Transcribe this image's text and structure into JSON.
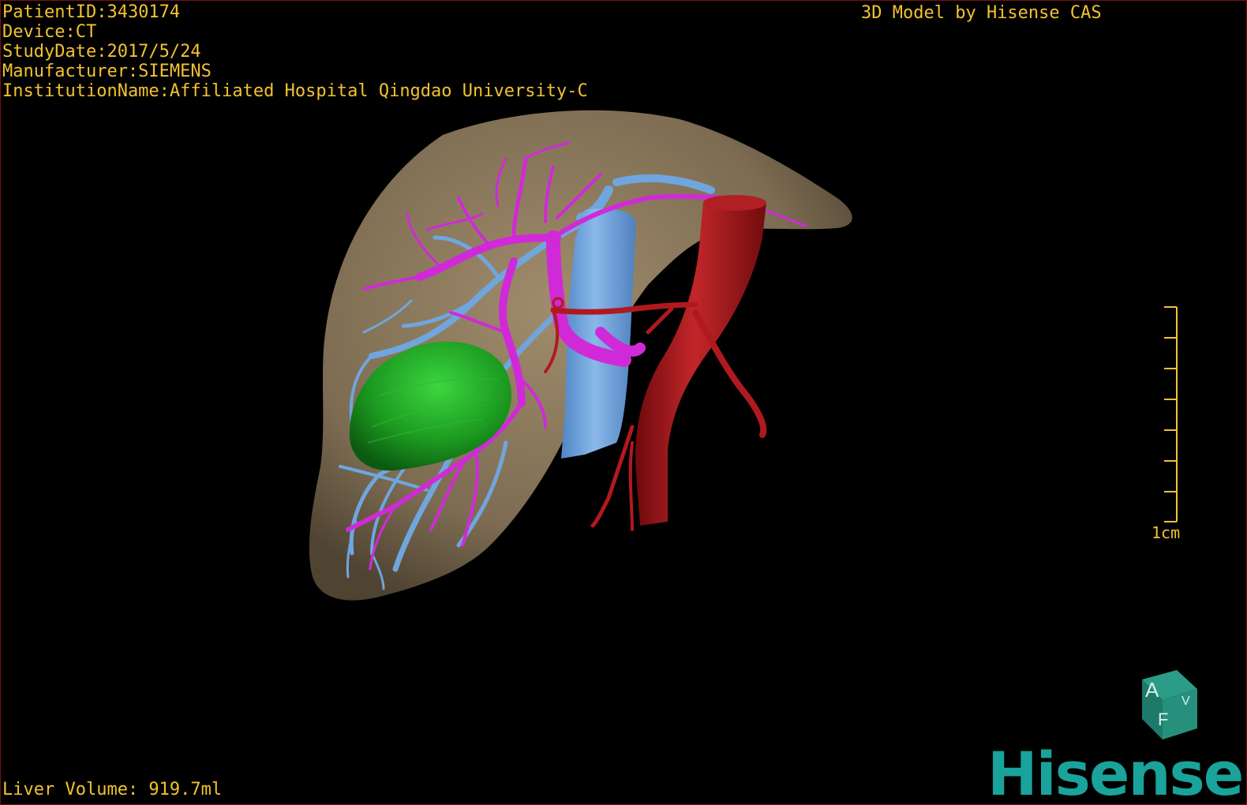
{
  "overlay": {
    "patient_id": "PatientID:3430174",
    "device": "Device:CT",
    "study_date": "StudyDate:2017/5/24",
    "manufacturer": "Manufacturer:SIEMENS",
    "institution": "InstitutionName:Affiliated Hospital Qingdao University-C",
    "credit": "3D Model by Hisense CAS",
    "liver_volume": "Liver Volume: 919.7ml",
    "scale_label": "1cm"
  },
  "orientation_cube": {
    "face_top": "A",
    "face_front": "F",
    "face_side": "V"
  },
  "brand": {
    "logo_text": "Hisense"
  },
  "colors": {
    "text": "#f2c230",
    "liver": "#8c7a5e",
    "portal_vein": "#d02ad8",
    "hepatic_vein": "#6aa2dc",
    "artery": "#a8181a",
    "tumor": "#1f9a22",
    "logo": "#1aa39a"
  }
}
